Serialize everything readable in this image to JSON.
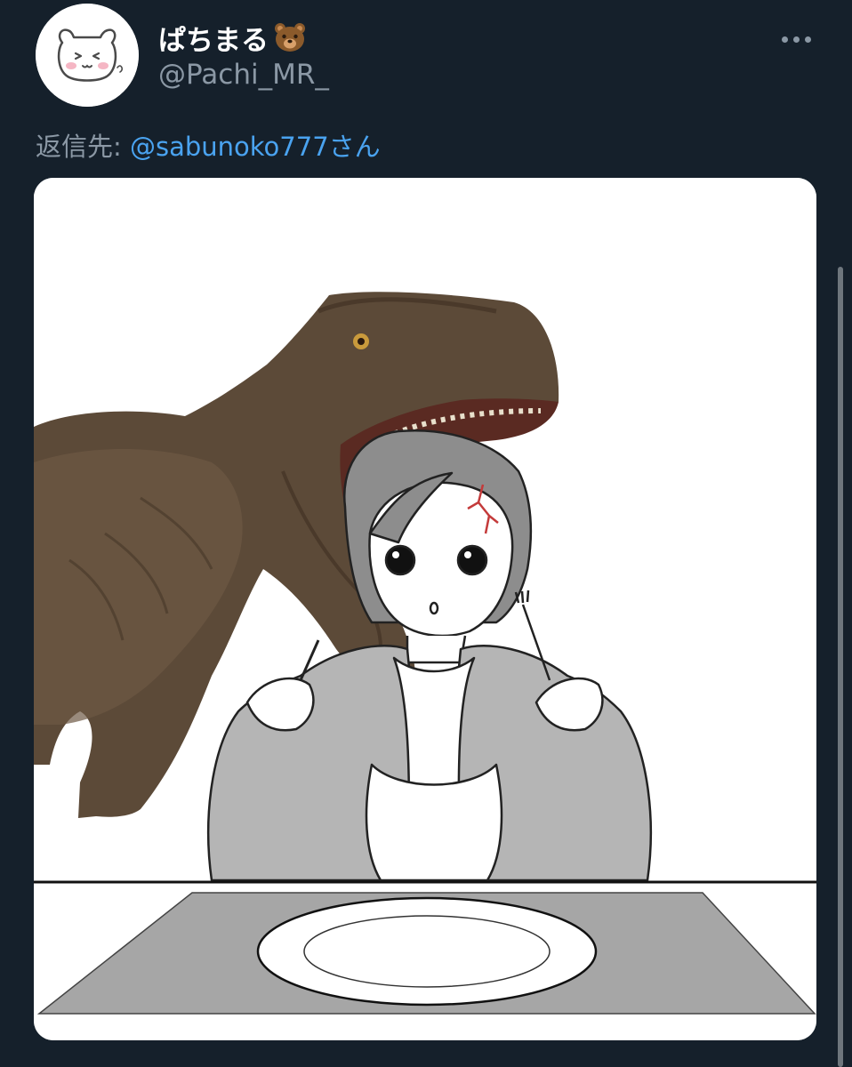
{
  "tweet": {
    "display_name": "ぱちまる",
    "handle": "@Pachi_MR_",
    "reply_prefix": "返信先: ",
    "reply_to": "@sabunoko777",
    "reply_suffix": "さん"
  },
  "icons": {
    "more": "more-horizontal-icon",
    "bear": "bear-face-emoji"
  },
  "colors": {
    "background": "#15202b",
    "text_primary": "#ffffff",
    "text_secondary": "#8b98a5",
    "link": "#4aa3f0"
  }
}
